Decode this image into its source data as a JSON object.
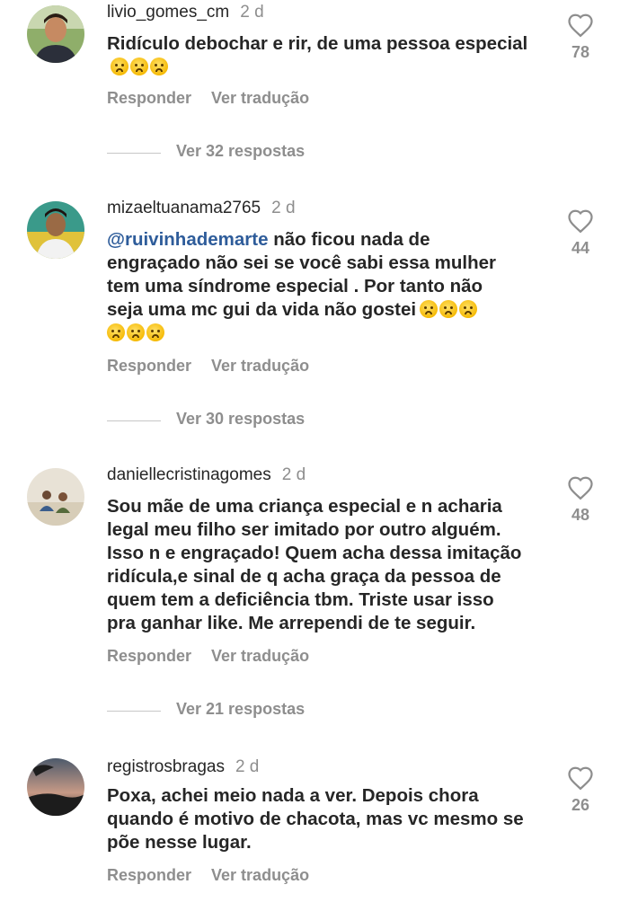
{
  "comments": [
    {
      "username": "livio_gomes_cm",
      "time": "2 d",
      "text_lines": [
        "Ridículo debochar e rir, de uma pessoa especial"
      ],
      "likes": "78",
      "reply_label": "Responder",
      "translate_label": "Ver tradução",
      "view_replies": "Ver 32 respostas"
    },
    {
      "username": "mizaeltuanama2765",
      "time": "2 d",
      "mention": "@ruivinhademarte",
      "text_lines": [
        "não  ficou nada de",
        "engraçado  não  sei se você  sabi essa mulher",
        "tem uma  síndrome especial . Por tanto  não",
        "seja uma mc gui  da vida  não  gostei"
      ],
      "likes": "44",
      "reply_label": "Responder",
      "translate_label": "Ver tradução",
      "view_replies": "Ver 30 respostas"
    },
    {
      "username": "daniellecristinagomes",
      "time": "2 d",
      "text_lines": [
        "Sou mãe de uma criança especial e n acharia",
        "legal meu filho ser imitado por outro alguém.",
        "Isso n e engraçado! Quem acha dessa imitação",
        "ridícula,e sinal de q acha graça da pessoa de",
        "quem tem a deficiência tbm. Triste usar isso",
        "pra ganhar like. Me arrependi de te seguir."
      ],
      "likes": "48",
      "reply_label": "Responder",
      "translate_label": "Ver tradução",
      "view_replies": "Ver 21 respostas"
    },
    {
      "username": "registrosbragas",
      "time": "2 d",
      "text_lines": [
        "Poxa, achei meio nada a ver. Depois chora",
        "quando é motivo de chacota, mas vc mesmo se",
        "põe nesse lugar."
      ],
      "likes": "26",
      "reply_label": "Responder",
      "translate_label": "Ver tradução"
    }
  ],
  "icons": {
    "like": "heart-outline-icon",
    "emoji": "sad-face-emoji"
  },
  "colors": {
    "text": "#262626",
    "muted": "#8e8e8e",
    "mention": "#2e5c9a",
    "divider": "#c7c7c7"
  }
}
